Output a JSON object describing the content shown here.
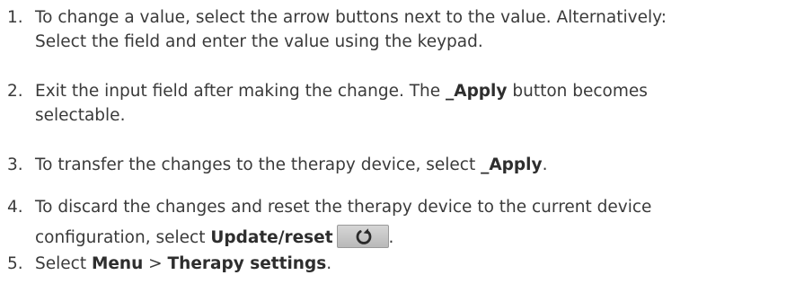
{
  "steps": [
    {
      "number": "1.",
      "line1": "To change a value, select the arrow buttons next to the value. Alternatively:",
      "line2": "Select the field and enter the value using the keypad."
    },
    {
      "number": "2.",
      "part1": "Exit the input field after making the change. The ",
      "bold1": "_Apply",
      "part2": " button becomes",
      "line2": "selectable."
    },
    {
      "number": "3.",
      "part1": "To transfer the changes to the therapy device, select ",
      "bold1": "_Apply",
      "part2": "."
    },
    {
      "number": "4.",
      "line1": "To discard the changes and reset the therapy device to the current device",
      "part1": "configuration, select ",
      "bold1": "Update/reset",
      "icon": "refresh-icon",
      "part2": "."
    },
    {
      "number": "5.",
      "part1": "Select ",
      "bold1": "Menu",
      "sep": " > ",
      "bold2": "Therapy settings",
      "part2": "."
    }
  ],
  "colors": {
    "text": "#3a3a3a",
    "button_bg": "#c8c8c8",
    "icon": "#2a2a2a"
  }
}
